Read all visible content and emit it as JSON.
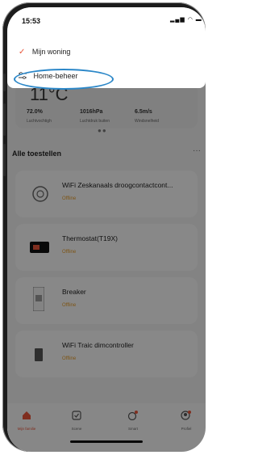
{
  "status_bar": {
    "time": "15:53"
  },
  "dropdown": {
    "items": [
      {
        "label": "Mijn woning",
        "selected": true
      },
      {
        "label": "Home-beheer"
      }
    ]
  },
  "weather": {
    "temperature": "11°C",
    "stats": [
      {
        "value": "72.0%",
        "label": "Luchtvochtigh"
      },
      {
        "value": "1016hPa",
        "label": "Luchtdruk buiten"
      },
      {
        "value": "6.5m/s",
        "label": "Windsnelheid"
      }
    ]
  },
  "devices": {
    "title": "Alle toestellen",
    "more": "···",
    "items": [
      {
        "name": "WiFi Zeskanaals droogcontactcont...",
        "status": "Offline",
        "icon": "relay-module-icon"
      },
      {
        "name": "Thermostat(T19X)",
        "status": "Offline",
        "icon": "thermostat-icon"
      },
      {
        "name": "Breaker",
        "status": "Offline",
        "icon": "breaker-icon"
      },
      {
        "name": "WiFi Traic dimcontroller",
        "status": "Offline",
        "icon": "dimmer-icon"
      }
    ]
  },
  "tabbar": {
    "tabs": [
      {
        "label": "Mijn familie",
        "icon": "home-icon",
        "active": true
      },
      {
        "label": "Scene",
        "icon": "scene-icon"
      },
      {
        "label": "Smart",
        "icon": "smart-icon"
      },
      {
        "label": "Profiel",
        "icon": "profile-icon"
      }
    ]
  },
  "colors": {
    "accent": "#e8553a",
    "offline": "#e39b2a",
    "highlight_ring": "#2b87c8"
  }
}
